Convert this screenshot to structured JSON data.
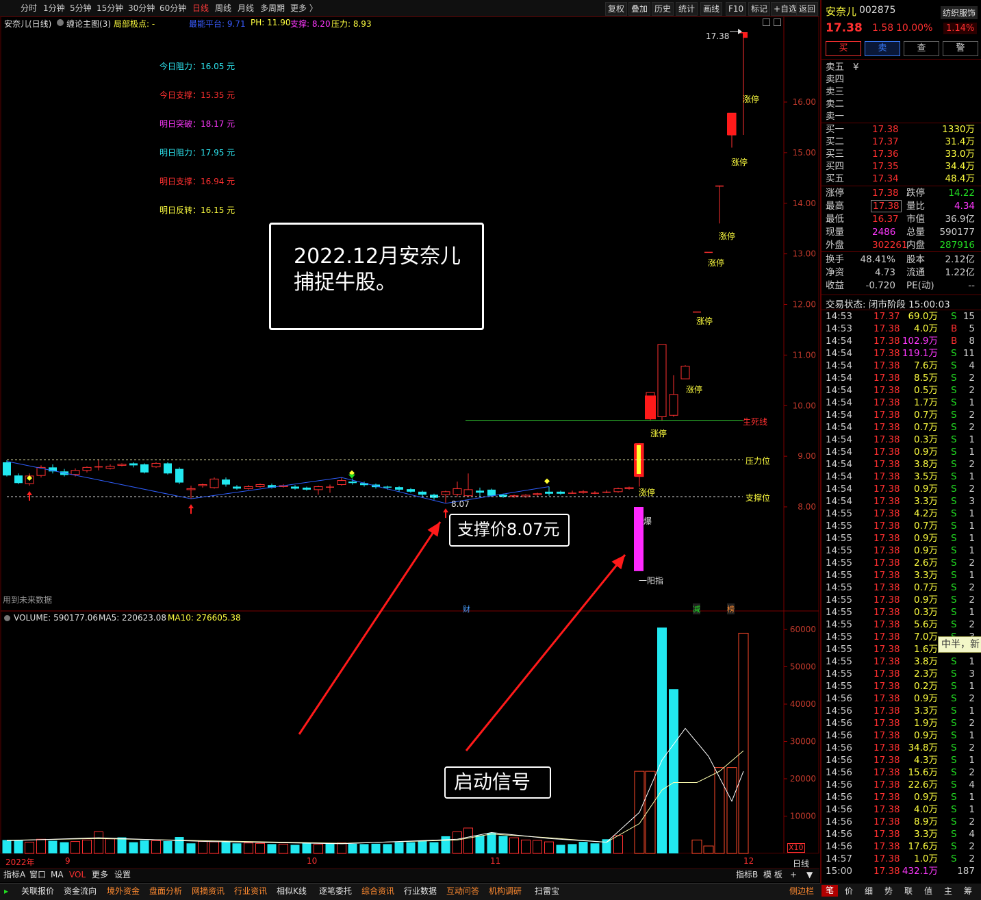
{
  "toolbar": {
    "periods": [
      "分时",
      "1分钟",
      "5分钟",
      "15分钟",
      "30分钟",
      "60分钟",
      "日线",
      "周线",
      "月线",
      "多周期",
      "更多 〉"
    ],
    "active": "日线",
    "tools": [
      "复权",
      "叠加",
      "历史",
      "统计",
      "画线",
      "F10",
      "标记",
      "+自选",
      "返回"
    ]
  },
  "indicator_bar": {
    "name": "安奈儿(日线)",
    "main_label": "缠论主图(3)",
    "extreme_label": "局部极点: -",
    "item1": "最能平台: 9.71",
    "item2": "PH: 11.90",
    "item3": "支撑: 8.20",
    "item4": "压力: 8.93"
  },
  "levels": [
    {
      "label": "今日阻力",
      "value": "16.05 元",
      "color": "#2ee6f0"
    },
    {
      "label": "今日支撑",
      "value": "15.35 元",
      "color": "#ff3030"
    },
    {
      "label": "明日突破",
      "value": "18.17 元",
      "color": "#ff38ff"
    },
    {
      "label": "明日阻力",
      "value": "17.95 元",
      "color": "#2ee6f0"
    },
    {
      "label": "明日支撑",
      "value": "16.94 元",
      "color": "#ff3030"
    },
    {
      "label": "明日反转",
      "value": "16.15 元",
      "color": "#ffff40"
    }
  ],
  "annotations": {
    "box_line1": "2022.12月安奈儿",
    "box_line2": "捕捉牛股。",
    "support_box": "支撑价8.07元",
    "signal_box": "启动信号",
    "support_mark": "8.07",
    "limit_up": "涨停",
    "high_mark": "17.38",
    "lifeline": "生死线",
    "pressure_line": "压力位",
    "support_line": "支撑位",
    "explode": "爆",
    "yangzhi": "一阳指",
    "future_data": "用到未来数据",
    "finance_mark": "财",
    "reduce_mark": "减",
    "grab_mark": "榜",
    "x10": "X10"
  },
  "price_axis": [
    "16.00",
    "15.00",
    "14.00",
    "13.00",
    "12.00",
    "11.00",
    "10.00",
    "9.00",
    "8.00"
  ],
  "volume_header": {
    "label": "VOLUME: 590177.06",
    "ma5": "MA5: 220623.08",
    "ma10": "MA10: 276605.38"
  },
  "volume_axis": [
    "60000",
    "50000",
    "40000",
    "30000",
    "20000",
    "10000"
  ],
  "x_labels": [
    "2022年",
    "9",
    "10",
    "11",
    "12"
  ],
  "x_period": "日线",
  "tabs": [
    "指标A",
    "窗口",
    "MA",
    "VOL",
    "更多",
    "设置"
  ],
  "tabs_right": [
    "指标B",
    "模 板",
    "+",
    "▼"
  ],
  "bottom": [
    "关联报价",
    "资金流向",
    "境外资金",
    "盘面分析",
    "网摘资讯",
    "行业资讯",
    "相似K线",
    "逐笔委托",
    "综合资讯",
    "行业数据",
    "互动问答",
    "机构调研",
    "扫雷宝"
  ],
  "bottom_right": [
    "侧边栏",
    "笔",
    "价",
    "细",
    "势",
    "联",
    "值",
    "主",
    "筹"
  ],
  "quote": {
    "name": "安奈儿",
    "code": "002875",
    "sector": "纺织服饰",
    "price": "17.38",
    "change": "1.58",
    "pct": "10.00%",
    "sector_pct": "1.14%",
    "buttons": [
      "买",
      "卖",
      "查",
      "警"
    ],
    "asks": [
      {
        "l": "卖五",
        "p": "¥",
        "v": ""
      },
      {
        "l": "卖四",
        "p": "",
        "v": ""
      },
      {
        "l": "卖三",
        "p": "",
        "v": ""
      },
      {
        "l": "卖二",
        "p": "",
        "v": ""
      },
      {
        "l": "卖一",
        "p": "",
        "v": ""
      }
    ],
    "bids": [
      {
        "l": "买一",
        "p": "17.38",
        "v": "1330万"
      },
      {
        "l": "买二",
        "p": "17.37",
        "v": "31.4万"
      },
      {
        "l": "买三",
        "p": "17.36",
        "v": "33.0万"
      },
      {
        "l": "买四",
        "p": "17.35",
        "v": "34.4万"
      },
      {
        "l": "买五",
        "p": "17.34",
        "v": "48.4万"
      }
    ],
    "stats": [
      {
        "l1": "涨停",
        "v1": "17.38",
        "c1": "#ff3030",
        "l2": "跌停",
        "v2": "14.22",
        "c2": "#22dd22"
      },
      {
        "l1": "最高",
        "v1": "17.38",
        "c1": "#ff3030",
        "l2": "量比",
        "v2": "4.34",
        "c2": "#ff38ff"
      },
      {
        "l1": "最低",
        "v1": "16.37",
        "c1": "#ff3030",
        "l2": "市值",
        "v2": "36.9亿",
        "c2": "#d0d0d0"
      },
      {
        "l1": "现量",
        "v1": "2486",
        "c1": "#ff38ff",
        "l2": "总量",
        "v2": "590177",
        "c2": "#d0d0d0"
      },
      {
        "l1": "外盘",
        "v1": "302261",
        "c1": "#ff3030",
        "l2": "内盘",
        "v2": "287916",
        "c2": "#22dd22"
      }
    ],
    "stats2": [
      {
        "l1": "换手",
        "v1": "48.41%",
        "l2": "股本",
        "v2": "2.12亿"
      },
      {
        "l1": "净资",
        "v1": "4.73",
        "l2": "流通",
        "v2": "1.22亿"
      },
      {
        "l1": "收益",
        "v1": "-0.720",
        "l2": "PE(动)",
        "v2": "--"
      }
    ],
    "status": "交易状态: 闭市阶段 15:00:03",
    "ticks": [
      [
        "14:53",
        "17.37",
        "69.0万",
        "S",
        "15"
      ],
      [
        "14:53",
        "17.38",
        "4.0万",
        "B",
        "5"
      ],
      [
        "14:54",
        "17.38",
        "102.9万",
        "B",
        "8"
      ],
      [
        "14:54",
        "17.38",
        "119.1万",
        "S",
        "11"
      ],
      [
        "14:54",
        "17.38",
        "7.6万",
        "S",
        "4"
      ],
      [
        "14:54",
        "17.38",
        "8.5万",
        "S",
        "2"
      ],
      [
        "14:54",
        "17.38",
        "0.5万",
        "S",
        "2"
      ],
      [
        "14:54",
        "17.38",
        "1.7万",
        "S",
        "1"
      ],
      [
        "14:54",
        "17.38",
        "0.7万",
        "S",
        "2"
      ],
      [
        "14:54",
        "17.38",
        "0.7万",
        "S",
        "2"
      ],
      [
        "14:54",
        "17.38",
        "0.3万",
        "S",
        "1"
      ],
      [
        "14:54",
        "17.38",
        "0.9万",
        "S",
        "1"
      ],
      [
        "14:54",
        "17.38",
        "3.8万",
        "S",
        "2"
      ],
      [
        "14:54",
        "17.38",
        "3.5万",
        "S",
        "1"
      ],
      [
        "14:54",
        "17.38",
        "0.9万",
        "S",
        "2"
      ],
      [
        "14:54",
        "17.38",
        "3.3万",
        "S",
        "3"
      ],
      [
        "14:55",
        "17.38",
        "4.2万",
        "S",
        "1"
      ],
      [
        "14:55",
        "17.38",
        "0.7万",
        "S",
        "1"
      ],
      [
        "14:55",
        "17.38",
        "0.9万",
        "S",
        "1"
      ],
      [
        "14:55",
        "17.38",
        "0.9万",
        "S",
        "1"
      ],
      [
        "14:55",
        "17.38",
        "2.6万",
        "S",
        "2"
      ],
      [
        "14:55",
        "17.38",
        "3.3万",
        "S",
        "1"
      ],
      [
        "14:55",
        "17.38",
        "0.7万",
        "S",
        "2"
      ],
      [
        "14:55",
        "17.38",
        "0.9万",
        "S",
        "2"
      ],
      [
        "14:55",
        "17.38",
        "0.3万",
        "S",
        "1"
      ],
      [
        "14:55",
        "17.38",
        "5.6万",
        "S",
        "2"
      ],
      [
        "14:55",
        "17.38",
        "7.0万",
        "S",
        "3"
      ],
      [
        "14:55",
        "17.38",
        "1.6万",
        "S",
        "1"
      ],
      [
        "14:55",
        "17.38",
        "3.8万",
        "S",
        "1"
      ],
      [
        "14:55",
        "17.38",
        "2.3万",
        "S",
        "3"
      ],
      [
        "14:55",
        "17.38",
        "0.2万",
        "S",
        "1"
      ],
      [
        "14:56",
        "17.38",
        "0.9万",
        "S",
        "2"
      ],
      [
        "14:56",
        "17.38",
        "3.3万",
        "S",
        "1"
      ],
      [
        "14:56",
        "17.38",
        "1.9万",
        "S",
        "2"
      ],
      [
        "14:56",
        "17.38",
        "0.9万",
        "S",
        "1"
      ],
      [
        "14:56",
        "17.38",
        "34.8万",
        "S",
        "2"
      ],
      [
        "14:56",
        "17.38",
        "4.3万",
        "S",
        "1"
      ],
      [
        "14:56",
        "17.38",
        "15.6万",
        "S",
        "2"
      ],
      [
        "14:56",
        "17.38",
        "22.6万",
        "S",
        "4"
      ],
      [
        "14:56",
        "17.38",
        "0.9万",
        "S",
        "1"
      ],
      [
        "14:56",
        "17.38",
        "4.0万",
        "S",
        "1"
      ],
      [
        "14:56",
        "17.38",
        "8.9万",
        "S",
        "2"
      ],
      [
        "14:56",
        "17.38",
        "3.3万",
        "S",
        "4"
      ],
      [
        "14:56",
        "17.38",
        "17.6万",
        "S",
        "2"
      ],
      [
        "14:57",
        "17.38",
        "1.0万",
        "S",
        "2"
      ],
      [
        "15:00",
        "17.38",
        "432.1万",
        "",
        "187"
      ]
    ],
    "float_tip": "中半，新"
  },
  "colors": {
    "up": "#ff3030",
    "down": "#22e8f0",
    "bg": "#000000",
    "axis": "#7a0000",
    "yellow": "#ffff40",
    "magenta": "#ff38ff"
  }
}
